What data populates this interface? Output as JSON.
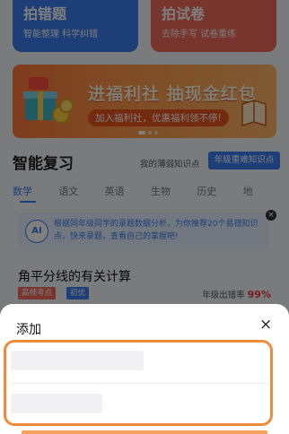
{
  "cards": {
    "left": {
      "title": "拍错题",
      "subtitle": "智能整理 科学纠错"
    },
    "right": {
      "title": "拍试卷",
      "subtitle": "去除手写 试卷重练"
    }
  },
  "banner": {
    "title": "进福利社 抽现金红包",
    "subtitle": "加入福利社，优惠福利领不停!"
  },
  "section": {
    "title": "智能复习",
    "weak_link": "我的薄弱知识点",
    "button": "年级重难知识点"
  },
  "tabs": [
    "数学",
    "语文",
    "英语",
    "生物",
    "历史",
    "地"
  ],
  "notice": {
    "ai_label": "AI",
    "text": "根据同年级同学的录题数据分析，为你推荐20个易错知识点，快来录题，查看自己的掌握吧!"
  },
  "knowledge": {
    "title": "角平分线的有关计算",
    "tag1": "高频考点",
    "tag2": "初优",
    "rate_label": "年级出错率",
    "rate_value": "99%"
  },
  "sheet": {
    "title": "添加",
    "close": "×",
    "options": [
      "",
      ""
    ]
  },
  "colors": {
    "accent": "#3d7cf0",
    "highlight": "#f08a3c",
    "danger": "#ee3a3a"
  }
}
